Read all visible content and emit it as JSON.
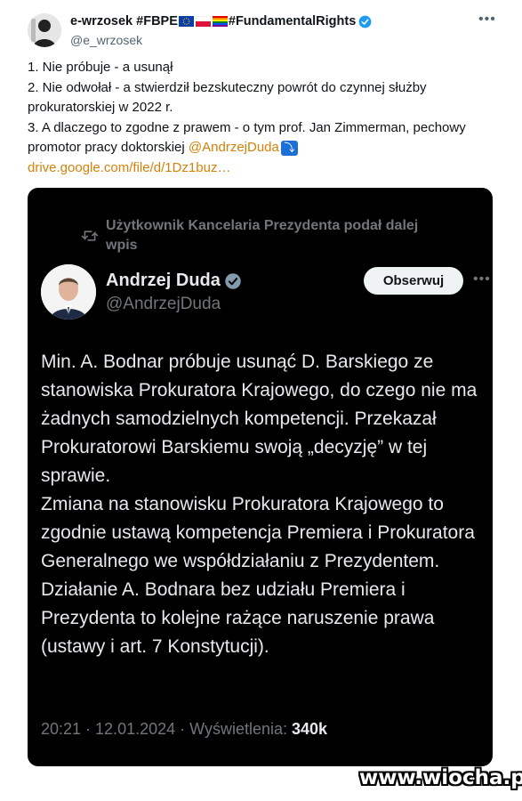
{
  "author": {
    "name_prefix": "e-wrzosek #FBPE",
    "name_suffix": "#FundamentalRights",
    "handle": "@e_wrzosek",
    "avatar": "person-silhouette-icon"
  },
  "tweet": {
    "lines": [
      "1. Nie próbuje - a usunął",
      "2. Nie odwołał - a stwierdził bezskuteczny powrót do czynnej służby prokuratorskiej w 2022 r.",
      "3. A dlaczego to zgodne z prawem - o tym prof. Jan Zimmerman, pechowy promotor pracy doktorskiej "
    ],
    "mention": "@AndrzejDuda",
    "link": "drive.google.com/file/d/1Dz1buz…"
  },
  "quoted": {
    "repost_label": "Użytkownik Kancelaria Prezydenta podał dalej wpis",
    "name": "Andrzej Duda",
    "handle": "@AndrzejDuda",
    "follow_label": "Obserwuj",
    "paragraphs": [
      "Min. A. Bodnar próbuje usunąć D. Barskiego ze stanowiska Prokuratora Krajowego, do czego nie ma żadnych samodzielnych kompetencji. Przekazał Prokuratorowi Barskiemu swoją „decyzję” w tej sprawie.",
      "Zmiana na stanowisku Prokuratora Krajowego to zgodnie ustawą kompetencja Premiera i Prokuratora Generalnego we współdziałaniu z Prezydentem.",
      "Działanie A. Bodnara bez udziału Premiera i Prezydenta to kolejne rażące naruszenie prawa (ustawy i art. 7 Konstytucji)."
    ],
    "timestamp": "20:21 · 12.01.2024 · Wyświetlenia: ",
    "views": "340k"
  },
  "watermark": "www.wiocha.pl",
  "colors": {
    "verified": "#1d9bf0",
    "accent": "#d4820a",
    "card_bg": "#000000"
  }
}
